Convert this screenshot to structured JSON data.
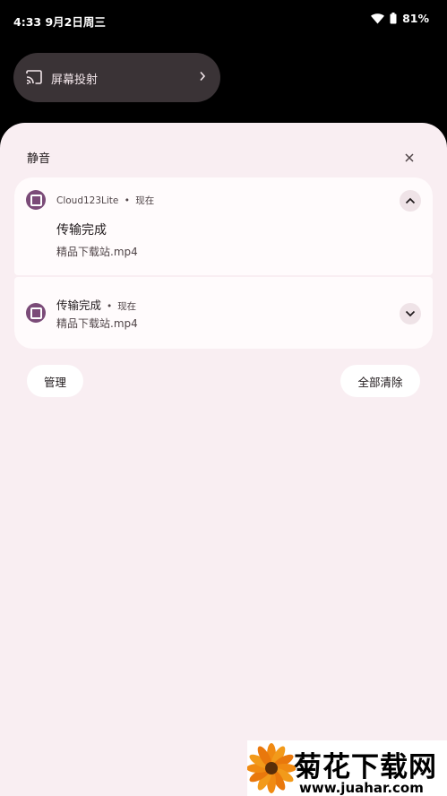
{
  "status_bar": {
    "time": "4:33",
    "date": "9月2日周三",
    "battery": "81%",
    "icons": [
      "wifi-icon",
      "battery-icon"
    ]
  },
  "cast_tile": {
    "label": "屏幕投射",
    "icon": "cast-icon"
  },
  "shade": {
    "section_title": "静音",
    "notifications": [
      {
        "app_name": "Cloud123Lite",
        "separator": "•",
        "time": "现在",
        "title": "传输完成",
        "body": "精品下载站.mp4",
        "expanded": true
      },
      {
        "title": "传输完成",
        "separator": "•",
        "time": "现在",
        "body": "精品下载站.mp4",
        "expanded": false
      }
    ],
    "manage_label": "管理",
    "clear_all_label": "全部清除"
  },
  "watermark": {
    "title": "菊花下载网",
    "url": "www.juahar.com"
  },
  "colors": {
    "background": "#000000",
    "shade": "#f9eef2",
    "card": "#fffbfc",
    "tile": "#3a3336",
    "app_icon": "#7b4b78"
  }
}
